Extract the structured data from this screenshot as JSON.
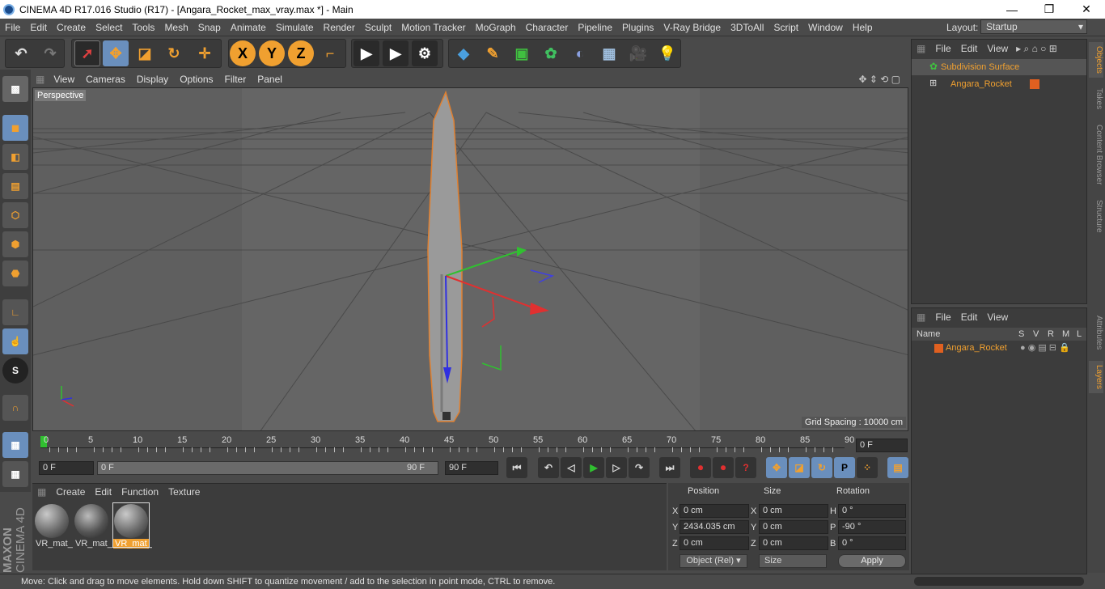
{
  "window": {
    "title": "CINEMA 4D R17.016 Studio (R17) - [Angara_Rocket_max_vray.max *] - Main",
    "min": "—",
    "max": "❐",
    "close": "✕"
  },
  "menubar": [
    "File",
    "Edit",
    "Create",
    "Select",
    "Tools",
    "Mesh",
    "Snap",
    "Animate",
    "Simulate",
    "Render",
    "Sculpt",
    "Motion Tracker",
    "MoGraph",
    "Character",
    "Pipeline",
    "Plugins",
    "V-Ray Bridge",
    "3DToAll",
    "Script",
    "Window",
    "Help"
  ],
  "layout": {
    "label": "Layout:",
    "value": "Startup"
  },
  "toolbar": {
    "x": "X",
    "y": "Y",
    "z": "Z"
  },
  "viewport": {
    "menu": [
      "View",
      "Cameras",
      "Display",
      "Options",
      "Filter",
      "Panel"
    ],
    "label": "Perspective",
    "grid_spacing": "Grid Spacing : 10000 cm"
  },
  "timeline": {
    "ticks": [
      "0",
      "5",
      "10",
      "15",
      "20",
      "25",
      "30",
      "35",
      "40",
      "45",
      "50",
      "55",
      "60",
      "65",
      "70",
      "75",
      "80",
      "85",
      "90"
    ],
    "current": "0 F"
  },
  "transport": {
    "start": "0 F",
    "slider_left": "0 F",
    "slider_right": "90 F",
    "end": "90 F"
  },
  "materials": {
    "menu": [
      "Create",
      "Edit",
      "Function",
      "Texture"
    ],
    "items": [
      "VR_mat_",
      "VR_mat_",
      "VR_mat_"
    ]
  },
  "coords": {
    "headers": [
      "Position",
      "Size",
      "Rotation"
    ],
    "rows": [
      {
        "axis": "X",
        "pos": "0 cm",
        "saxis": "X",
        "size": "0 cm",
        "raxis": "H",
        "rot": "0 °"
      },
      {
        "axis": "Y",
        "pos": "2434.035 cm",
        "saxis": "Y",
        "size": "0 cm",
        "raxis": "P",
        "rot": "-90 °"
      },
      {
        "axis": "Z",
        "pos": "0 cm",
        "saxis": "Z",
        "size": "0 cm",
        "raxis": "B",
        "rot": "0 °"
      }
    ],
    "mode": "Object (Rel)",
    "size_mode": "Size",
    "apply": "Apply"
  },
  "objects": {
    "menu": [
      "File",
      "Edit",
      "View"
    ],
    "items": [
      "Subdivision Surface",
      "Angara_Rocket"
    ]
  },
  "layers": {
    "menu": [
      "File",
      "Edit",
      "View"
    ],
    "columns": [
      "Name",
      "S",
      "V",
      "R",
      "M",
      "L"
    ],
    "items": [
      "Angara_Rocket"
    ]
  },
  "right_tabs": [
    "Objects",
    "Takes",
    "Content Browser",
    "Structure",
    "Attributes",
    "Layers"
  ],
  "status": "Move: Click and drag to move elements. Hold down SHIFT to quantize movement / add to the selection in point mode, CTRL to remove.",
  "branding": {
    "maxon": "MAXON",
    "product": "CINEMA 4D"
  },
  "colors": {
    "accent": "#f0a030",
    "selected": "#6a8fbd",
    "viewport": "#5e5e5e"
  }
}
